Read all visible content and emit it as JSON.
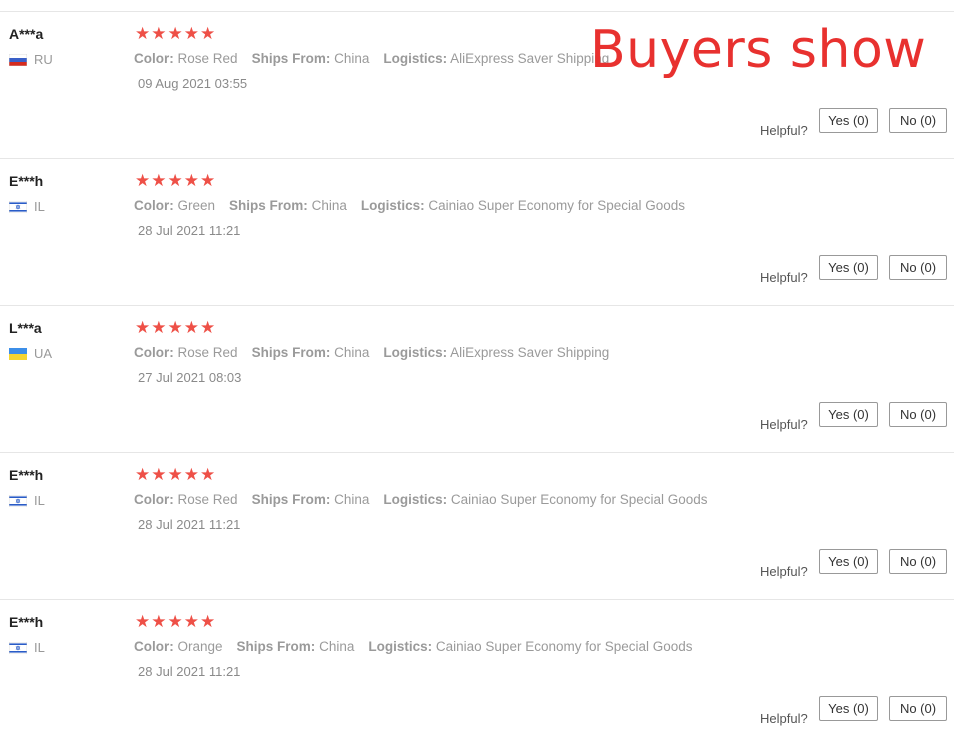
{
  "watermark": "Buyers show",
  "labels": {
    "color": "Color:",
    "ships_from": "Ships From:",
    "logistics": "Logistics:",
    "helpful": "Helpful?"
  },
  "colors": {
    "star": "#ee5047",
    "watermark": "#e8312f"
  },
  "reviews": [
    {
      "user": "A***a",
      "country": "RU",
      "flag_icon": "russia-flag-icon",
      "rating": 5,
      "color": "Rose Red",
      "ships_from": "China",
      "logistics": "AliExpress Saver Shipping",
      "date": "09 Aug 2021 03:55",
      "yes": "Yes (0)",
      "no": "No (0)"
    },
    {
      "user": "E***h",
      "country": "IL",
      "flag_icon": "israel-flag-icon",
      "rating": 5,
      "color": "Green",
      "ships_from": "China",
      "logistics": "Cainiao Super Economy for Special Goods",
      "date": "28 Jul 2021 11:21",
      "yes": "Yes (0)",
      "no": "No (0)"
    },
    {
      "user": "L***a",
      "country": "UA",
      "flag_icon": "ukraine-flag-icon",
      "rating": 5,
      "color": "Rose Red",
      "ships_from": "China",
      "logistics": "AliExpress Saver Shipping",
      "date": "27 Jul 2021 08:03",
      "yes": "Yes (0)",
      "no": "No (0)"
    },
    {
      "user": "E***h",
      "country": "IL",
      "flag_icon": "israel-flag-icon",
      "rating": 5,
      "color": "Rose Red",
      "ships_from": "China",
      "logistics": "Cainiao Super Economy for Special Goods",
      "date": "28 Jul 2021 11:21",
      "yes": "Yes (0)",
      "no": "No (0)"
    },
    {
      "user": "E***h",
      "country": "IL",
      "flag_icon": "israel-flag-icon",
      "rating": 5,
      "color": "Orange",
      "ships_from": "China",
      "logistics": "Cainiao Super Economy for Special Goods",
      "date": "28 Jul 2021 11:21",
      "yes": "Yes (0)",
      "no": "No (0)"
    }
  ]
}
